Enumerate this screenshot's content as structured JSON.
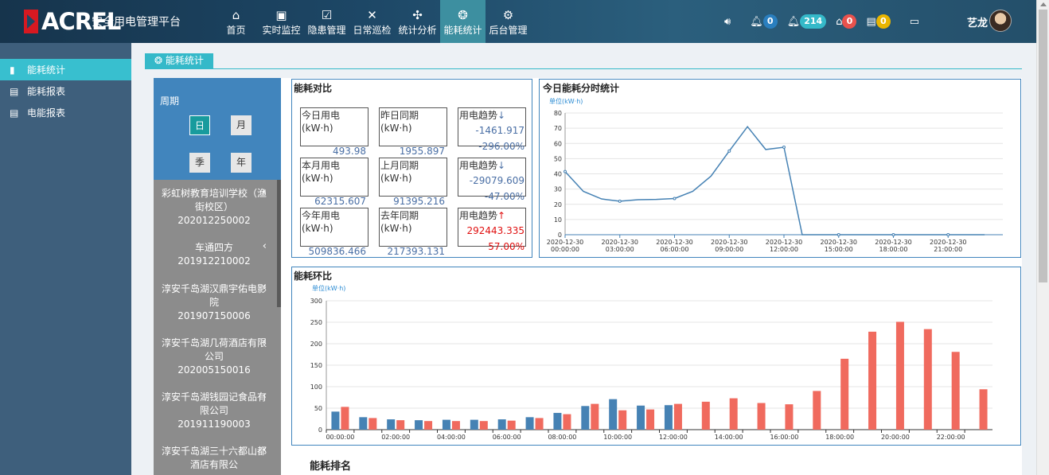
{
  "header": {
    "brand": "ACREL",
    "system_title": "安全用电管理平台",
    "nav": [
      {
        "label": "首页",
        "icon": "home-icon"
      },
      {
        "label": "实时监控",
        "icon": "monitor-icon"
      },
      {
        "label": "隐患管理",
        "icon": "clipboard-icon"
      },
      {
        "label": "日常巡检",
        "icon": "tools-icon"
      },
      {
        "label": "统计分析",
        "icon": "fan-icon"
      },
      {
        "label": "能耗统计",
        "icon": "energy-icon"
      },
      {
        "label": "后台管理",
        "icon": "gears-icon"
      }
    ],
    "badges": {
      "alarm1": "0",
      "alarm2": "214",
      "home": "0",
      "list": "0"
    },
    "user_name": "艺龙"
  },
  "sidebar": {
    "items": [
      {
        "label": "能耗统计"
      },
      {
        "label": "能耗报表"
      },
      {
        "label": "电能报表"
      }
    ]
  },
  "page_tab": "能耗统计",
  "period": {
    "label": "周期",
    "buttons": [
      "日",
      "月",
      "季",
      "年"
    ]
  },
  "sites": [
    {
      "name": "彩虹树教育培训学校（渔街校区）",
      "code": "202012250002"
    },
    {
      "name": "车通四方",
      "code": "201912210002"
    },
    {
      "name": "淳安千岛湖汉鼎宇佑电影院",
      "code": "201907150006"
    },
    {
      "name": "淳安千岛湖几荷酒店有限公司",
      "code": "202005150016"
    },
    {
      "name": "淳安千岛湖钱园记食品有限公司",
      "code": "201911190003"
    },
    {
      "name": "淳安千岛湖三十六都山都酒店有限公",
      "code": ""
    }
  ],
  "compare": {
    "title": "能耗对比",
    "unit": "(kW·h)",
    "rows": [
      {
        "current_label": "今日用电",
        "current_value": "493.98",
        "prev_label": "昨日同期",
        "prev_value": "1955.897",
        "trend_label": "用电趋势",
        "trend_arrow": "↓",
        "trend_value": "-1461.917",
        "trend_pct": "-296.00%",
        "trend_dir": "down"
      },
      {
        "current_label": "本月用电",
        "current_value": "62315.607",
        "prev_label": "上月同期",
        "prev_value": "91395.216",
        "trend_label": "用电趋势",
        "trend_arrow": "↓",
        "trend_value": "-29079.609",
        "trend_pct": "-47.00%",
        "trend_dir": "down"
      },
      {
        "current_label": "今年用电",
        "current_value": "509836.466",
        "prev_label": "去年同期",
        "prev_value": "217393.131",
        "trend_label": "用电趋势",
        "trend_arrow": "↑",
        "trend_value": "292443.335",
        "trend_pct": "57.00%",
        "trend_dir": "up"
      }
    ]
  },
  "hourly_title": "今日能耗分时统计",
  "ring_title": "能耗环比",
  "rank_title": "能耗排名",
  "chart_data": [
    {
      "type": "line",
      "title": "今日能耗分时统计",
      "ylabel": "单位(kW·h)",
      "ylim": [
        0,
        80
      ],
      "yticks": [
        0,
        10,
        20,
        30,
        40,
        50,
        60,
        70,
        80
      ],
      "xlim": [
        0,
        24
      ],
      "xtick_labels": [
        {
          "date": "2020-12-30",
          "time": "00:00:00",
          "hour": 0
        },
        {
          "date": "2020-12-30",
          "time": "03:00:00",
          "hour": 3
        },
        {
          "date": "2020-12-30",
          "time": "06:00:00",
          "hour": 6
        },
        {
          "date": "2020-12-30",
          "time": "09:00:00",
          "hour": 9
        },
        {
          "date": "2020-12-30",
          "time": "12:00:00",
          "hour": 12
        },
        {
          "date": "2020-12-30",
          "time": "15:00:00",
          "hour": 15
        },
        {
          "date": "2020-12-30",
          "time": "18:00:00",
          "hour": 18
        },
        {
          "date": "2020-12-30",
          "time": "21:00:00",
          "hour": 21
        }
      ],
      "x": [
        0,
        1,
        2,
        3,
        4,
        5,
        6,
        7,
        8,
        9,
        10,
        11,
        12,
        13,
        14,
        15,
        16,
        17,
        18,
        19,
        20,
        21,
        22,
        23
      ],
      "values": [
        41.5,
        28.5,
        23.5,
        22,
        23,
        23.2,
        23.8,
        28.5,
        38.5,
        55,
        71,
        56,
        57.5,
        0,
        0,
        0,
        0,
        0,
        0,
        0,
        0,
        0,
        0,
        0
      ],
      "color": "#4682b4",
      "grid": true
    },
    {
      "type": "bar",
      "title": "能耗环比",
      "ylabel": "单位(kW·h)",
      "ylim": [
        0,
        300
      ],
      "yticks": [
        0,
        50,
        100,
        150,
        200,
        250,
        300
      ],
      "categories": [
        "00:00:00",
        "01:00:00",
        "02:00:00",
        "03:00:00",
        "04:00:00",
        "05:00:00",
        "06:00:00",
        "07:00:00",
        "08:00:00",
        "09:00:00",
        "10:00:00",
        "11:00:00",
        "12:00:00",
        "13:00:00",
        "14:00:00",
        "15:00:00",
        "16:00:00",
        "17:00:00",
        "18:00:00",
        "19:00:00",
        "20:00:00",
        "21:00:00",
        "22:00:00",
        "23:00:00"
      ],
      "xtick_every": 2,
      "series": [
        {
          "values": [
            42,
            29,
            24,
            22,
            23,
            23,
            24,
            29,
            39,
            55,
            71,
            56,
            57,
            0,
            0,
            0,
            0,
            0,
            0,
            0,
            0,
            0,
            0,
            0
          ],
          "color": "#4682b4"
        },
        {
          "values": [
            53,
            27,
            22,
            20,
            20,
            20,
            21,
            27,
            36,
            60,
            45,
            47,
            60,
            65,
            73,
            62,
            59,
            90,
            165,
            228,
            251,
            234,
            181,
            94
          ],
          "color": "#f06a5e"
        }
      ],
      "grid": true
    }
  ]
}
